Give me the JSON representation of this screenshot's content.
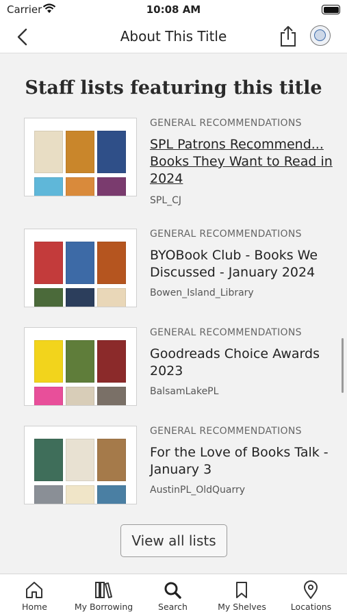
{
  "status_bar": {
    "carrier": "Carrier",
    "time": "10:08 AM"
  },
  "nav": {
    "title": "About This Title",
    "icons": [
      "back-chevron-icon",
      "share-icon",
      "library-logo-icon"
    ]
  },
  "section": {
    "heading": "Staff lists featuring this title"
  },
  "lists": [
    {
      "category": "GENERAL RECOMMENDATIONS",
      "title": "SPL Patrons Recommend... Books They Want to Read in 2024",
      "user": "SPL_CJ"
    },
    {
      "category": "GENERAL RECOMMENDATIONS",
      "title": "BYOBook Club - Books We Discussed - January 2024",
      "user": "Bowen_Island_Library"
    },
    {
      "category": "GENERAL RECOMMENDATIONS",
      "title": "Goodreads Choice Awards 2023",
      "user": "BalsamLakePL"
    },
    {
      "category": "GENERAL RECOMMENDATIONS",
      "title": "For the Love of Books Talk - January 3",
      "user": "AustinPL_OldQuarry"
    }
  ],
  "view_all_label": "View all lists",
  "tabs": [
    {
      "label": "Home",
      "icon": "home-icon"
    },
    {
      "label": "My Borrowing",
      "icon": "books-icon"
    },
    {
      "label": "Search",
      "icon": "search-icon"
    },
    {
      "label": "My Shelves",
      "icon": "bookmark-icon"
    },
    {
      "label": "Locations",
      "icon": "location-pin-icon"
    }
  ]
}
